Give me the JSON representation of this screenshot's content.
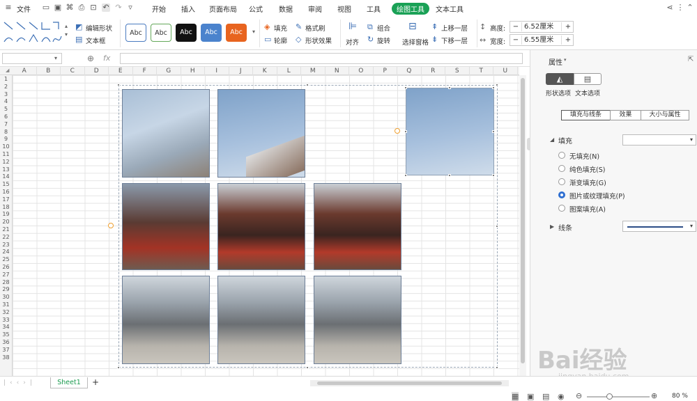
{
  "menubar": {
    "file": "文件",
    "tabs": [
      "开始",
      "插入",
      "页面布局",
      "公式",
      "数据",
      "审阅",
      "视图",
      "工具",
      "绘图工具",
      "文本工具"
    ]
  },
  "ribbon": {
    "edit_shape": "编辑形状",
    "text_box": "文本框",
    "style_sample": "Abc",
    "fill": "填充",
    "format_brush": "格式刷",
    "outline": "轮廓",
    "shape_effect": "形状效果",
    "align": "对齐",
    "group": "组合",
    "rotate": "旋转",
    "selection_pane": "选择窗格",
    "bring_forward": "上移一层",
    "send_backward": "下移一层",
    "height_label": "高度:",
    "height_value": "6.52厘米",
    "width_label": "宽度:",
    "width_value": "6.55厘米",
    "minus": "−",
    "plus": "+"
  },
  "formula": {
    "fx": "fx",
    "zoom_icon": "⊕"
  },
  "grid": {
    "columns": [
      "A",
      "B",
      "C",
      "D",
      "E",
      "F",
      "G",
      "H",
      "I",
      "J",
      "K",
      "L",
      "M",
      "N",
      "O",
      "P",
      "Q",
      "R",
      "S",
      "T",
      "U"
    ],
    "rows": [
      "1",
      "2",
      "3",
      "4",
      "5",
      "6",
      "7",
      "8",
      "9",
      "10",
      "11",
      "12",
      "13",
      "14",
      "15",
      "16",
      "17",
      "18",
      "19",
      "20",
      "21",
      "22",
      "23",
      "24",
      "25",
      "26",
      "27",
      "28",
      "29",
      "30",
      "31",
      "32",
      "33",
      "34",
      "35",
      "36",
      "37",
      "38"
    ]
  },
  "panel": {
    "title": "属性",
    "tab_shape": "形状选项",
    "tab_text": "文本选项",
    "seg_fill_line": "填充与线条",
    "seg_effect": "效果",
    "seg_size": "大小与属性",
    "fill_section": "填充",
    "fill_options": [
      "无填充(N)",
      "纯色填充(S)",
      "渐变填充(G)",
      "图片或纹理填充(P)",
      "图案填充(A)"
    ],
    "line_section": "线条"
  },
  "status": {
    "sheet": "Sheet1",
    "add_sheet": "+",
    "zoom": "80 %"
  },
  "watermark": {
    "brand": "Bai经验",
    "url": "jingyan.baidu.com"
  }
}
